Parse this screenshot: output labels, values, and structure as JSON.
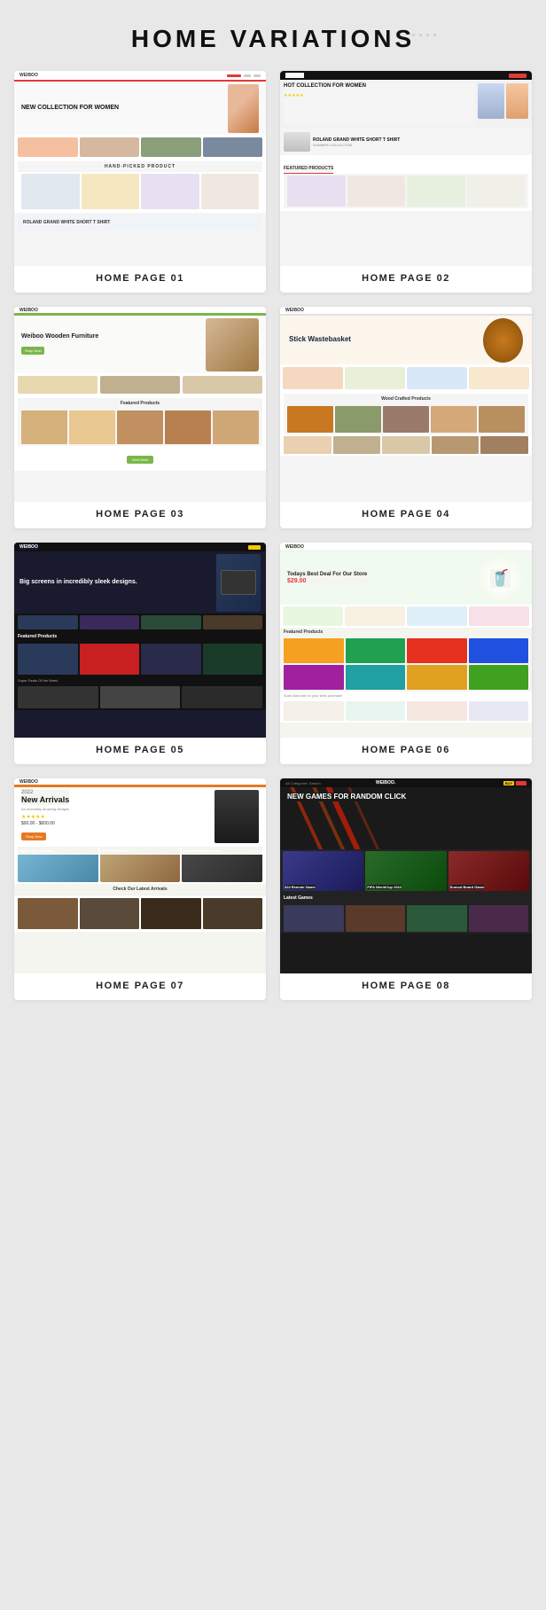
{
  "page": {
    "title": "HOME VARIATIONS",
    "cards": [
      {
        "id": "hp01",
        "label": "HOME PAGE 01"
      },
      {
        "id": "hp02",
        "label": "HOME PAGE 02"
      },
      {
        "id": "hp03",
        "label": "HOME PAGE 03"
      },
      {
        "id": "hp04",
        "label": "HOME PAGE 04"
      },
      {
        "id": "hp05",
        "label": "HOME PAGE 05"
      },
      {
        "id": "hp06",
        "label": "HOME PAGE 06"
      },
      {
        "id": "hp07",
        "label": "HOME PAGE 07"
      },
      {
        "id": "hp08",
        "label": "HOME PAGE 08"
      }
    ],
    "hp01": {
      "hero_title": "NEW COLLECTION FOR WOMEN",
      "banner_text": "ROLAND GRAND WHITE SHORT T SHIRT"
    },
    "hp02": {
      "hero_title": "HOT COLLECTION FOR WOMEN",
      "banner_text": "ROLAND GRAND WHITE SHORT T SHIRT",
      "feat_label": "FEATURED PRODUCTS"
    },
    "hp03": {
      "hero_title": "Weiboo Wooden Furniture",
      "feat_label": "Featured Products"
    },
    "hp04": {
      "hero_title": "Stick Wastebasket",
      "feat_label": "Wood Crafted Products"
    },
    "hp05": {
      "hero_title": "Big screens in incredibly sleek designs.",
      "feat_label": "Featured Products",
      "deals_label": "Super Deals Of the Week"
    },
    "hp06": {
      "hero_title": "Todays Best Deal For Our Store",
      "hero_price": "$29.00",
      "feat_label": "Featured Products"
    },
    "hp07": {
      "hero_year": "2022",
      "hero_title": "New Arrivals",
      "cat1": "Splash Into Summer",
      "cat2": "20% Off For You",
      "cat3": "Special Edition Shoes",
      "check_label": "Check Our Latest Arrivals"
    },
    "hp08": {
      "hero_title": "NEW GAMES FOR RANDOM CLICK",
      "cat1": "324 Remote Game",
      "cat2": "FIFA WorldCup 2022",
      "cat3": "Sunout Board Game",
      "feat_label": "Latest Games"
    }
  }
}
